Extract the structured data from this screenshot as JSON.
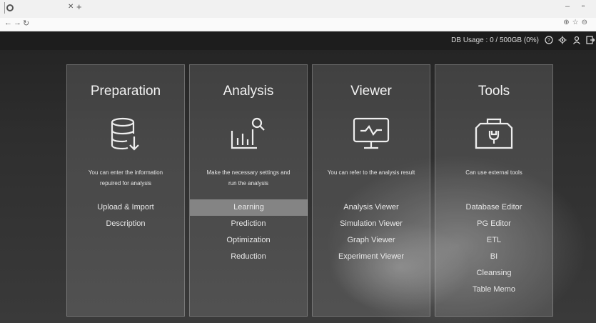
{
  "topbar": {
    "db_usage": "DB Usage : 0 / 500GB (0%)"
  },
  "cards": [
    {
      "title": "Preparation",
      "icon": "database-download-icon",
      "description": "You can enter the information\nrepuired for analysis",
      "items": [
        "Upload & Import",
        "Description"
      ]
    },
    {
      "title": "Analysis",
      "icon": "chart-search-icon",
      "description": "Make the necessary settings and\nrun the analysis",
      "items": [
        "Learning",
        "Prediction",
        "Optimization",
        "Reduction"
      ],
      "active_item": "Learning"
    },
    {
      "title": "Viewer",
      "icon": "monitor-chart-icon",
      "description": "You can refer to the analysis result",
      "items": [
        "Analysis Viewer",
        "Simulation Viewer",
        "Graph Viewer",
        "Experiment Viewer"
      ]
    },
    {
      "title": "Tools",
      "icon": "toolbox-icon",
      "description": "Can use external tools",
      "items": [
        "Database Editor",
        "PG Editor",
        "ETL",
        "BI",
        "Cleansing",
        "Table Memo"
      ]
    }
  ]
}
